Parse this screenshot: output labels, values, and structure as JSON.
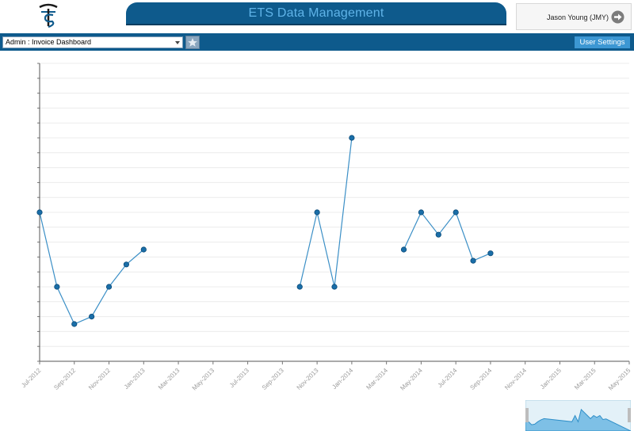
{
  "header": {
    "app_title": "ETS Data Management",
    "user_name": "Jason Young (JMY)"
  },
  "toolbar": {
    "dashboard_select_value": "Admin : Invoice Dashboard",
    "user_settings_label": "User Settings"
  },
  "icons": {
    "logo": "ets-logo-icon",
    "user": "arrow-right-circle-icon",
    "favorite": "star-icon",
    "dropdown": "chevron-down-icon"
  },
  "colors": {
    "brand": "#0e5a8c",
    "title_text": "#5fb3e8",
    "settings_button": "#3c97d3",
    "series_line": "#3b8fc6",
    "series_point": "#1a6ea8"
  },
  "chart_data": {
    "type": "line",
    "x_tick_labels": [
      "Jul-2012",
      "Sep-2012",
      "Nov-2012",
      "Jan-2013",
      "Mar-2013",
      "May-2013",
      "Jul-2013",
      "Sep-2013",
      "Nov-2013",
      "Jan-2014",
      "Mar-2014",
      "May-2014",
      "Jul-2014",
      "Sep-2014",
      "Nov-2014",
      "Jan-2015",
      "Mar-2015",
      "May-2015"
    ],
    "x_range": [
      "2012-07",
      "2015-05"
    ],
    "y_range": [
      0,
      20
    ],
    "grid": true,
    "y_tick_labels_visible": false,
    "segments": [
      [
        {
          "x": "2012-07",
          "y": 10
        },
        {
          "x": "2012-08",
          "y": 5
        },
        {
          "x": "2012-09",
          "y": 2.5
        },
        {
          "x": "2012-10",
          "y": 3
        },
        {
          "x": "2012-11",
          "y": 5
        },
        {
          "x": "2012-12",
          "y": 6.5
        },
        {
          "x": "2013-01",
          "y": 7.5
        }
      ],
      [
        {
          "x": "2013-10",
          "y": 5
        },
        {
          "x": "2013-11",
          "y": 10
        },
        {
          "x": "2013-12",
          "y": 5
        },
        {
          "x": "2014-01",
          "y": 15
        }
      ],
      [
        {
          "x": "2014-04",
          "y": 7.5
        },
        {
          "x": "2014-05",
          "y": 10
        },
        {
          "x": "2014-06",
          "y": 8.5
        },
        {
          "x": "2014-07",
          "y": 10
        },
        {
          "x": "2014-08",
          "y": 6.75
        },
        {
          "x": "2014-09",
          "y": 7.25
        }
      ]
    ]
  }
}
